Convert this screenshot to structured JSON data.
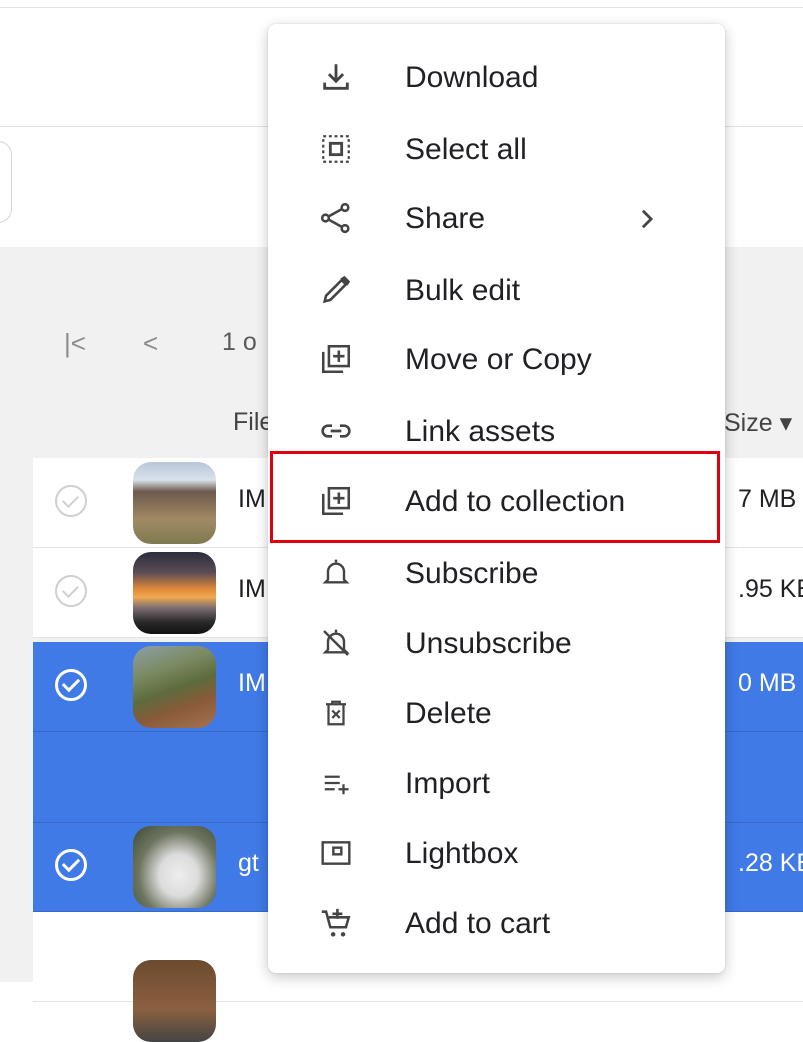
{
  "pagination": {
    "first": "|<",
    "prev": "<",
    "text": "1 o"
  },
  "columns": {
    "file": "File",
    "size": "Size ▾"
  },
  "rows": [
    {
      "name": "IM",
      "size": "7 MB",
      "selected": false
    },
    {
      "name": "IM",
      "size": ".95 KE",
      "selected": false
    },
    {
      "name": "IM",
      "size": "0 MB",
      "selected": true
    },
    {
      "name": "gt",
      "size": ".28 KE",
      "selected": true
    }
  ],
  "menu": {
    "items": [
      {
        "label": "Download",
        "icon": "download-icon"
      },
      {
        "label": "Select all",
        "icon": "select-all-icon"
      },
      {
        "label": "Share",
        "icon": "share-icon",
        "submenu": true
      },
      {
        "label": "Bulk edit",
        "icon": "pencil-icon"
      },
      {
        "label": "Move or Copy",
        "icon": "move-copy-icon"
      },
      {
        "label": "Link assets",
        "icon": "link-icon"
      },
      {
        "label": "Add to collection",
        "icon": "add-collection-icon",
        "highlighted": true
      },
      {
        "label": "Subscribe",
        "icon": "bell-icon"
      },
      {
        "label": "Unsubscribe",
        "icon": "bell-off-icon"
      },
      {
        "label": "Delete",
        "icon": "trash-icon"
      },
      {
        "label": "Import",
        "icon": "import-icon"
      },
      {
        "label": "Lightbox",
        "icon": "lightbox-icon"
      },
      {
        "label": "Add to cart",
        "icon": "cart-add-icon"
      }
    ]
  },
  "colors": {
    "selected_row": "#3f7ae6",
    "highlight_border": "#e00010",
    "icon": "#444444"
  }
}
